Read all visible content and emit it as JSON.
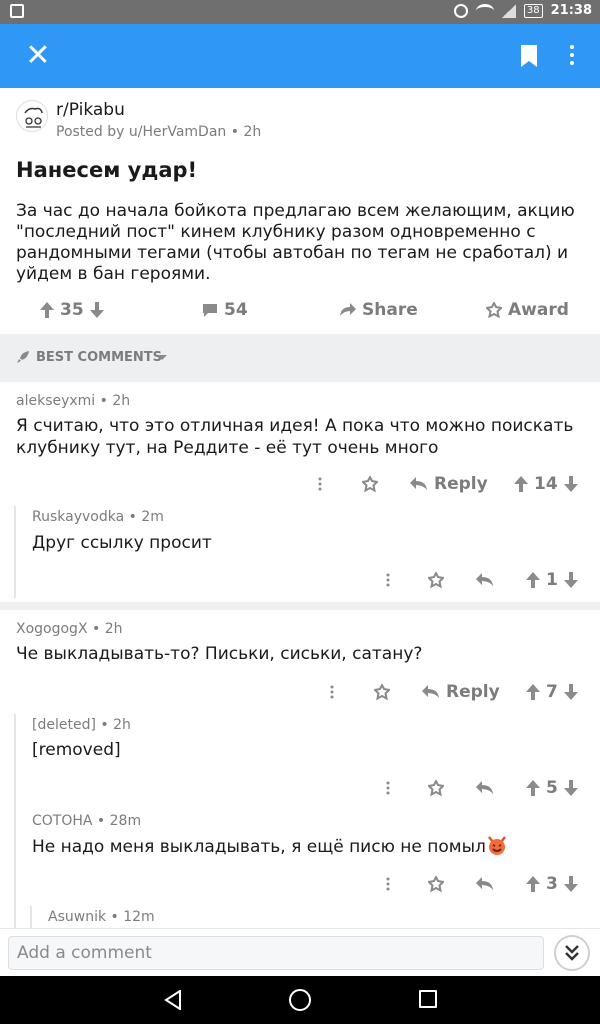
{
  "status_bar": {
    "time": "21:38",
    "battery": "38"
  },
  "header": {
    "close_icon": "close-icon",
    "bookmark_icon": "bookmark-icon",
    "more_icon": "more-vertical-icon"
  },
  "post": {
    "subreddit": "r/Pikabu",
    "posted_by": "Posted by u/HerVamDan • 2h",
    "title": "Нанесем удар!",
    "body": "За час до начала бойкота предлагаю всем желающим, акцию \"последний пост\" кинем клубнику разом одновременно с рандомными тегами (чтобы автобан по тегам не сработал) и уйдем в бан героями.",
    "score": "35",
    "comments_count": "54",
    "share_label": "Share",
    "award_label": "Award"
  },
  "sort": {
    "label": "BEST COMMENTS"
  },
  "comments": [
    {
      "meta": "alekseyxmi • 2h",
      "text": "Я считаю, что это отличная идея! А пока что можно поискать клубнику тут, на Реддите - её тут очень много",
      "reply_label": "Reply",
      "score": "14"
    },
    {
      "meta": "Ruskayvodka • 2m",
      "text": "Друг ссылку просит",
      "score": "1"
    },
    {
      "meta": "XogogogX • 2h",
      "text": "Че выкладывать-то? Письки, сиськи, сатану?",
      "reply_label": "Reply",
      "score": "7"
    },
    {
      "meta": "[deleted] • 2h",
      "text": "[removed]",
      "score": "5"
    },
    {
      "meta": "СОТОНА • 28m",
      "text": "Не надо меня выкладывать, я ещё писю не помыл",
      "score": "3"
    },
    {
      "meta": "Asuwnik • 12m"
    }
  ],
  "comment_input": {
    "placeholder": "Add a comment"
  },
  "colors": {
    "appbar": "#2f97f5",
    "muted": "#7c7c7c",
    "separator": "#edeff1"
  }
}
